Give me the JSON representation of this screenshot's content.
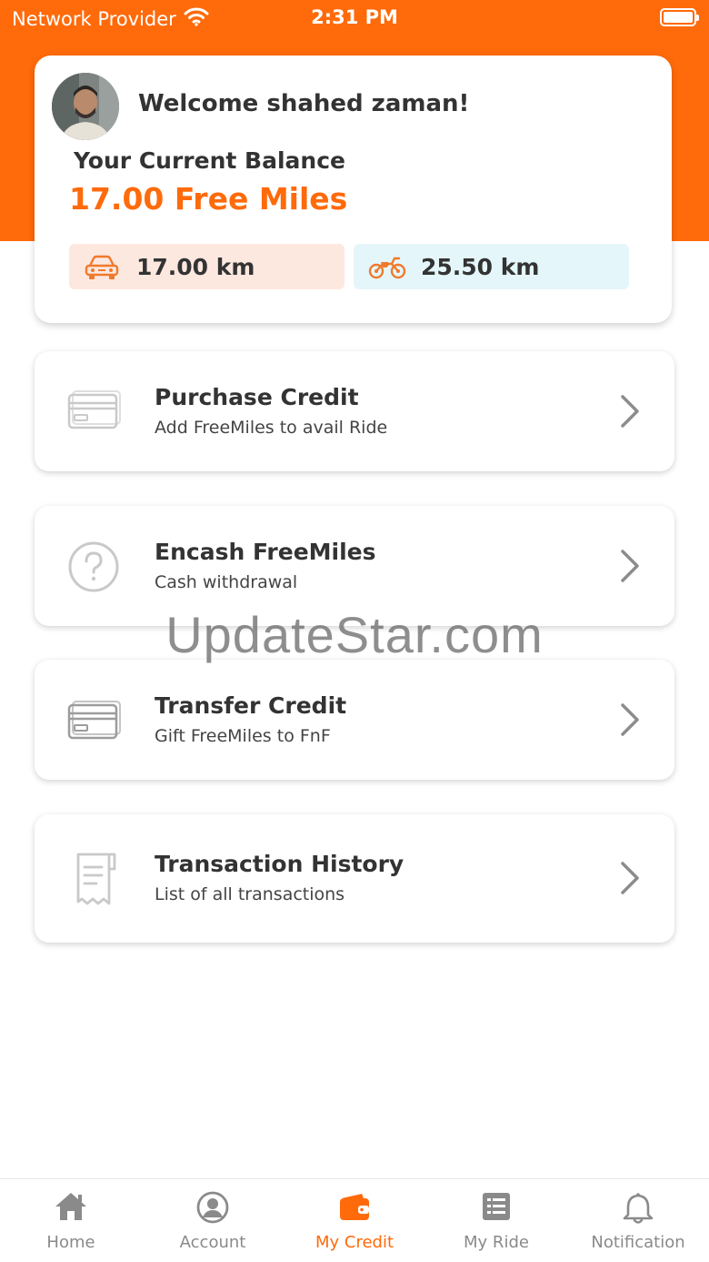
{
  "status_bar": {
    "carrier": "Network Provider",
    "time": "2:31 PM",
    "wifi_icon": "wifi-icon",
    "battery_icon": "battery-icon"
  },
  "balance_card": {
    "welcome": "Welcome shahed zaman!",
    "balance_label": "Your Current Balance",
    "balance_value": "17.00 Free Miles",
    "car": {
      "icon": "car-icon",
      "value": "17.00 km"
    },
    "bike": {
      "icon": "motorbike-icon",
      "value": "25.50 km"
    }
  },
  "menu": [
    {
      "title": "Purchase Credit",
      "subtitle": "Add FreeMiles to avail Ride",
      "icon": "credit-card-icon"
    },
    {
      "title": "Encash FreeMiles",
      "subtitle": "Cash withdrawal",
      "icon": "question-circle-icon"
    },
    {
      "title": "Transfer Credit",
      "subtitle": "Gift FreeMiles to FnF",
      "icon": "credit-card-icon"
    },
    {
      "title": "Transaction History",
      "subtitle": "List of all transactions",
      "icon": "receipt-icon"
    }
  ],
  "watermark": "UpdateStar.com",
  "bottom_nav": [
    {
      "label": "Home",
      "icon": "home-icon",
      "active": false
    },
    {
      "label": "Account",
      "icon": "user-circle-icon",
      "active": false
    },
    {
      "label": "My Credit",
      "icon": "wallet-icon",
      "active": true
    },
    {
      "label": "My Ride",
      "icon": "list-icon",
      "active": false
    },
    {
      "label": "Notification",
      "icon": "bell-icon",
      "active": false
    }
  ],
  "colors": {
    "accent": "#ff6a0a",
    "text_dark": "#333333",
    "nav_inactive": "#8a8a8a",
    "car_pill_bg": "#fde8e0",
    "bike_pill_bg": "#e5f6fb"
  }
}
